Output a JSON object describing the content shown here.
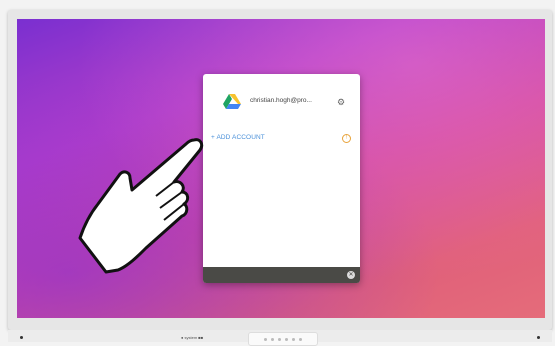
{
  "taskbar": {
    "label": "● system ■■"
  },
  "panel": {
    "account_email": "christian.hogh@pro...",
    "add_account_label": "+ ADD ACCOUNT",
    "icons": {
      "drive": "google-drive-icon",
      "settings": "gear-icon",
      "info": "info-icon",
      "close": "close-icon"
    }
  },
  "colors": {
    "link": "#4a90d9",
    "warning": "#e8a33a",
    "footer": "#4a4a46"
  }
}
